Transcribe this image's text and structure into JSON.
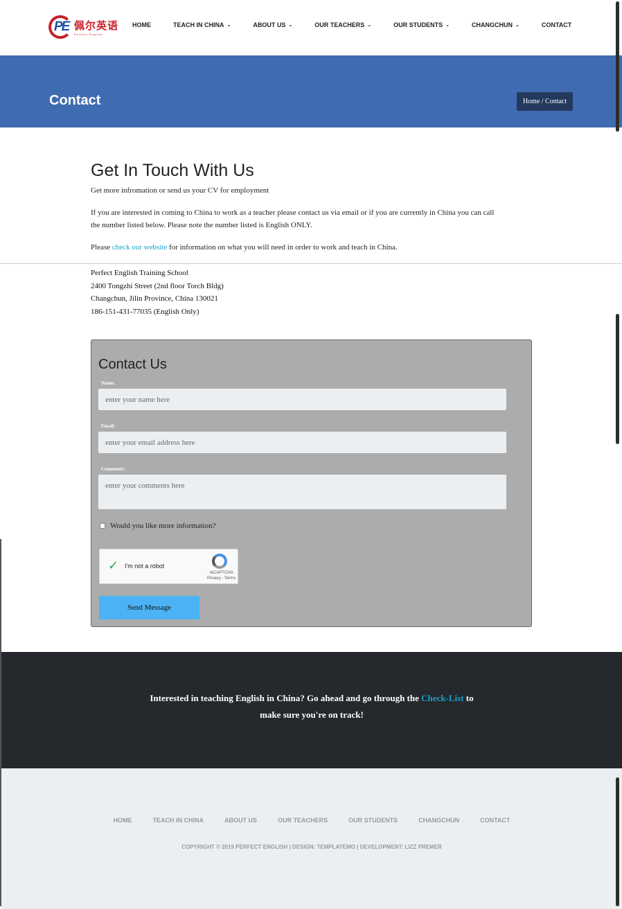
{
  "logo": {
    "mark": "PE",
    "cn": "佩尔英语",
    "en": "Perfect English"
  },
  "nav": [
    {
      "label": "HOME",
      "has_menu": false
    },
    {
      "label": "TEACH IN CHINA",
      "has_menu": true
    },
    {
      "label": "ABOUT US",
      "has_menu": true
    },
    {
      "label": "OUR TEACHERS",
      "has_menu": true
    },
    {
      "label": "OUR STUDENTS",
      "has_menu": true
    },
    {
      "label": "CHANGCHUN",
      "has_menu": true
    },
    {
      "label": "CONTACT",
      "has_menu": false
    }
  ],
  "banner": {
    "title": "Contact",
    "breadcrumb": "Home / Contact",
    "color": "#3f6cb1"
  },
  "intro": {
    "heading": "Get In Touch With Us",
    "subheading": "Get more infromation or send us your CV for employment",
    "para1_line1": "If you are interested in coming to China to work as a teacher please contact us via email or if you are currently in China you can call",
    "para1_line2": "the number listed below. Please note the number listed is English ONLY.",
    "para2_before": "Please ",
    "para2_link": "check our website",
    "para2_after": " for information on what you will need in order to work and teach in China."
  },
  "address": {
    "name": "Perfect English Training School",
    "street": "2400 Tongzhi Street (2nd floor Torch Bldg)",
    "city": "Changchun, Jilin Province, China 130021",
    "phone": "186-151-431-77035 (English Only)"
  },
  "form": {
    "title": "Contact Us",
    "name_label": "Name:",
    "name_placeholder": "enter your name here",
    "email_label": "Email:",
    "email_placeholder": "enter your email address here",
    "comments_label": "Comments:",
    "comments_placeholder": "enter your comments here",
    "checkbox_label": "Would you like more information?",
    "captcha_text": "I'm not a robot",
    "captcha_brand": "reCAPTCHA",
    "captcha_links": "Privacy - Terms",
    "send_label": "Send Message"
  },
  "cta": {
    "line1_before": "Interested in teaching English in China? Go ahead and go through the ",
    "link": "Check-List",
    "line1_after": " to",
    "line2": "make sure you're on track!"
  },
  "footer": {
    "links": [
      "HOME",
      "TEACH IN CHINA",
      "ABOUT US",
      "OUR TEACHERS",
      "OUR STUDENTS",
      "CHANGCHUN",
      "CONTACT"
    ],
    "copyright": "COPYRIGHT © 2019 PERFECT ENGLISH | DESIGN: TEMPLATEMO | DEVELOPMENT: LIZZ PREMER"
  },
  "colors": {
    "accent_link": "#1b9dc8",
    "send_button": "#4bb3f5",
    "cta_bg": "#25282c",
    "footer_bg": "#eceff2"
  }
}
